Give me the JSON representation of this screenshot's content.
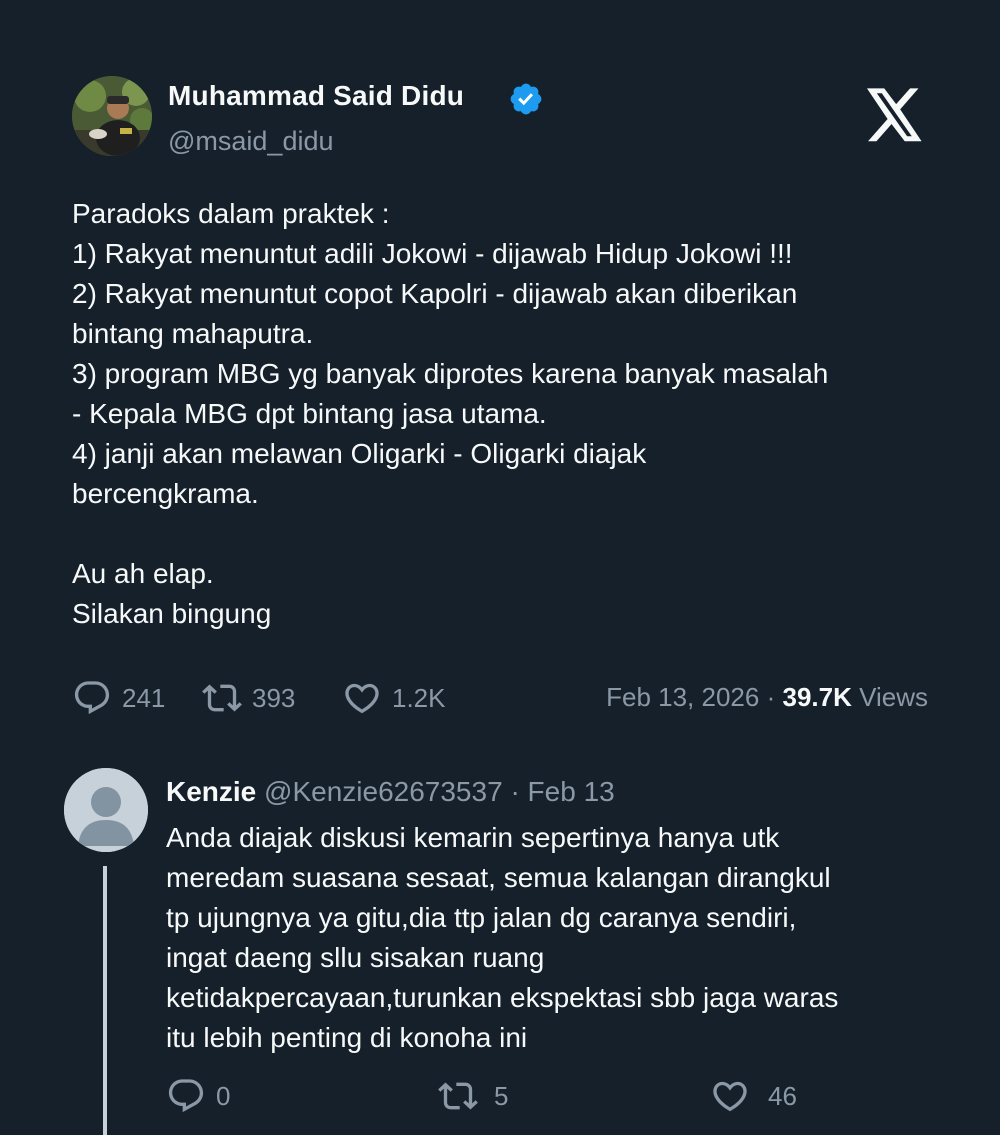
{
  "author": {
    "display_name": "Muhammad Said Didu",
    "handle": "@msaid_didu",
    "verified": true,
    "avatar": "profile-photo"
  },
  "logo": "x-logo-icon",
  "tweet": {
    "lines": [
      "Paradoks dalam praktek :",
      "1) Rakyat menuntut adili Jokowi - dijawab Hidup Jokowi !!!",
      "2) Rakyat menuntut copot Kapolri - dijawab akan diberikan",
      "bintang mahaputra.",
      "3) program MBG yg banyak diprotes karena banyak masalah",
      "- Kepala MBG dpt bintang jasa utama.",
      "4) janji akan melawan Oligarki - Oligarki diajak",
      "bercengkrama.",
      "",
      "Au ah elap.",
      "Silakan bingung"
    ],
    "stats": {
      "replies": "241",
      "retweets": "393",
      "likes": "1.2K"
    },
    "date": "Feb 13, 2026",
    "separator": "·",
    "views_count": "39.7K",
    "views_label": "Views"
  },
  "reply": {
    "display_name": "Kenzie",
    "handle": "@Kenzie62673537",
    "separator": "·",
    "date": "Feb 13",
    "lines": [
      "Anda diajak diskusi kemarin sepertinya hanya utk",
      "meredam suasana sesaat, semua kalangan dirangkul",
      "tp ujungnya ya gitu,dia ttp jalan dg caranya sendiri,",
      "ingat daeng sllu sisakan ruang",
      "ketidakpercayaan,turunkan ekspektasi sbb jaga waras",
      "itu lebih penting di konoha ini"
    ],
    "stats": {
      "replies": "0",
      "retweets": "5",
      "likes": "46"
    }
  },
  "colors": {
    "background": "#15202b",
    "text": "#f7f9f9",
    "muted": "#8b98a5",
    "verified": "#1d9bf0",
    "default_avatar": "#c7d1da"
  }
}
